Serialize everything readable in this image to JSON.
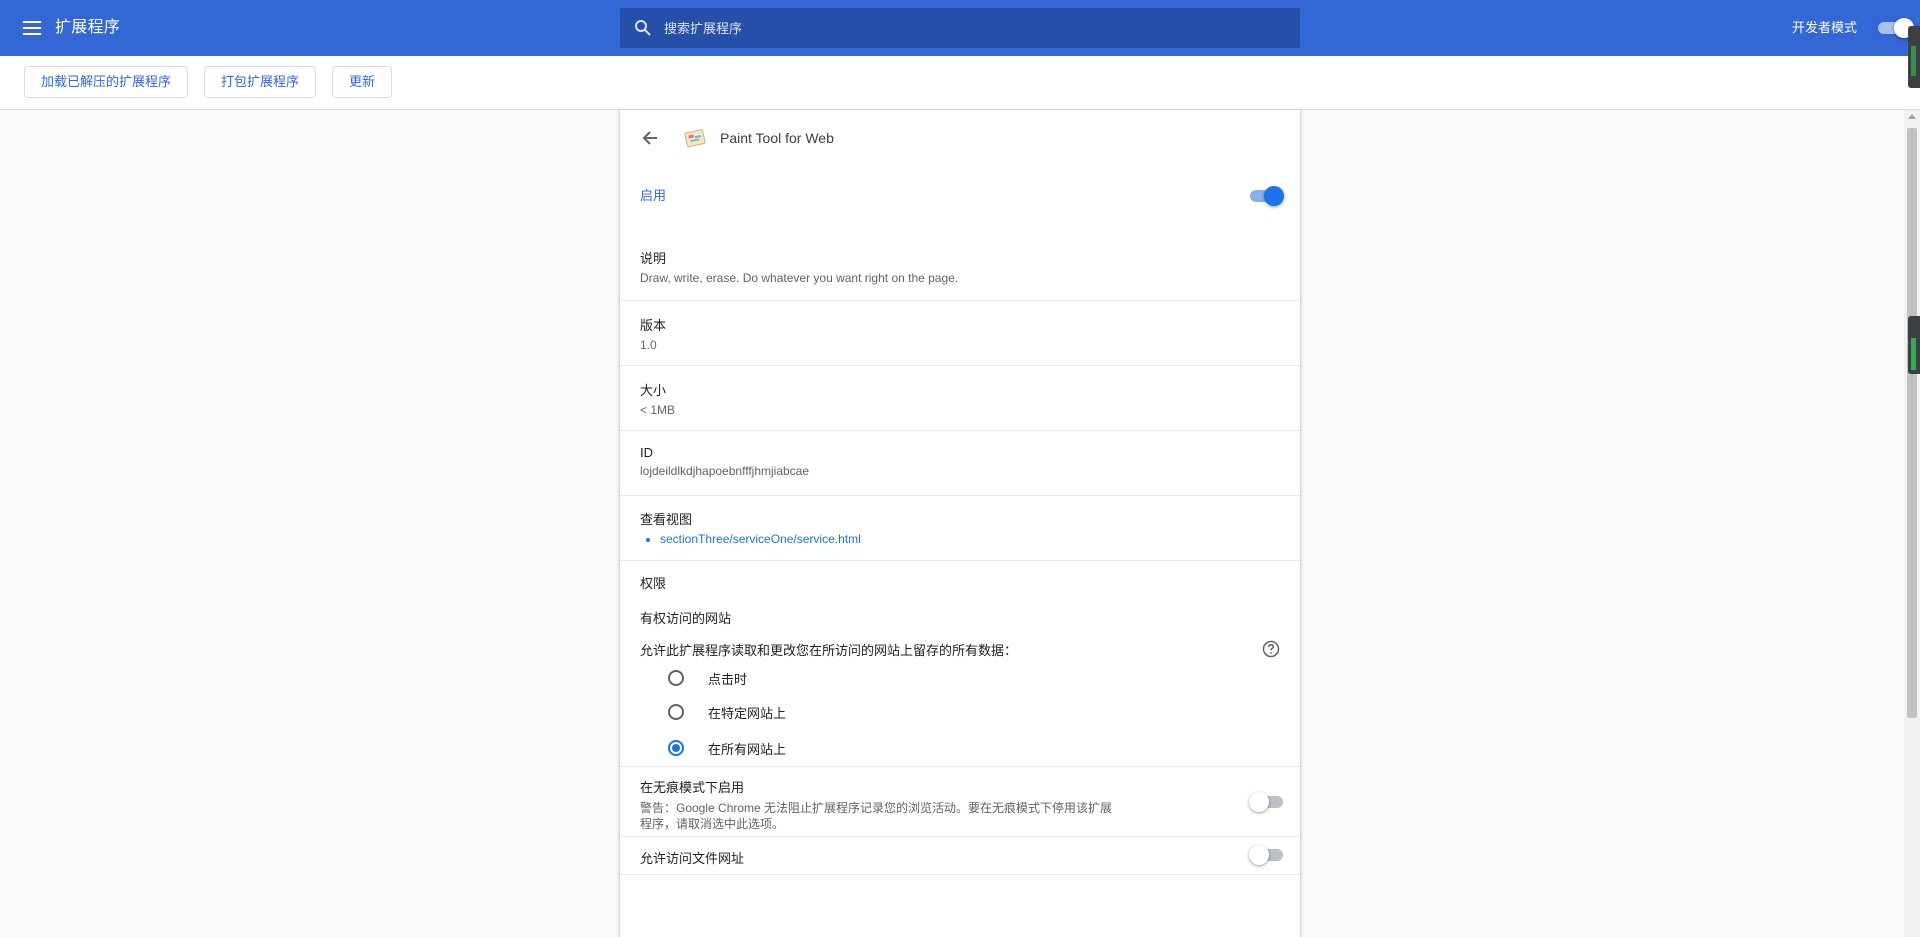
{
  "header": {
    "menu_icon": "menu-icon",
    "title": "扩展程序",
    "search_placeholder": "搜索扩展程序",
    "developer_mode_label": "开发者模式",
    "developer_mode_on": true
  },
  "toolbar": {
    "load_unpacked": "加载已解压的扩展程序",
    "pack_extension": "打包扩展程序",
    "update": "更新"
  },
  "extension": {
    "name": "Paint Tool for Web",
    "enabled_label": "启用",
    "enabled": true,
    "description_label": "说明",
    "description": "Draw, write, erase. Do whatever you want right on the page.",
    "version_label": "版本",
    "version": "1.0",
    "size_label": "大小",
    "size": "< 1MB",
    "id_label": "ID",
    "id": "lojdeildlkdjhapoebnfffjhmjiabcae",
    "inspect_views_label": "查看视图",
    "inspect_views": [
      "sectionThree/serviceOne/service.html"
    ],
    "permissions_label": "权限",
    "site_access_label": "有权访问的网站",
    "site_access_description": "允许此扩展程序读取和更改您在所访问的网站上留存的所有数据：",
    "site_access_options": [
      {
        "label": "点击时",
        "checked": false
      },
      {
        "label": "在特定网站上",
        "checked": false
      },
      {
        "label": "在所有网站上",
        "checked": true
      }
    ],
    "incognito_label": "在无痕模式下启用",
    "incognito_warning": "警告：Google Chrome 无法阻止扩展程序记录您的浏览活动。要在无痕模式下停用该扩展程序，请取消选中此选项。",
    "incognito_enabled": false,
    "file_urls_label": "允许访问文件网址",
    "file_urls_enabled": false
  },
  "colors": {
    "header_bg": "#3367d6",
    "accent": "#1a73e8",
    "page_bg": "#f8f9fa"
  }
}
